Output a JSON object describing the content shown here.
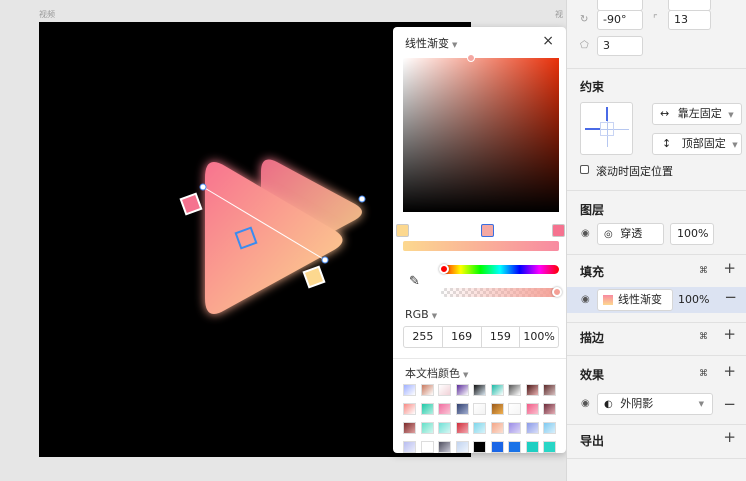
{
  "canvas": {
    "label_left": "视频",
    "label_right": "视"
  },
  "color_picker": {
    "fill_type": "线性渐变",
    "close": "×",
    "stops": [
      "#fcd88f",
      "#f4a8a3",
      "#f5728f"
    ],
    "gradient": [
      "#fcd88f",
      "#f88aa1"
    ],
    "mode": "RGB",
    "values": [
      "255",
      "169",
      "159",
      "100%"
    ],
    "document_colors": "本文档颜色"
  },
  "panel": {
    "rotation": "-90°",
    "radius": "13",
    "sides": "3",
    "constraints": {
      "title": "约束",
      "horizontal": "靠左固定",
      "vertical": "顶部固定",
      "fixed_scroll": "滚动时固定位置"
    },
    "layer": {
      "title": "图层",
      "blend": "穿透",
      "opacity": "100%"
    },
    "fill": {
      "title": "填充",
      "type": "线性渐变",
      "opacity": "100%"
    },
    "stroke": {
      "title": "描边"
    },
    "effects": {
      "title": "效果",
      "shadow": "外阴影"
    },
    "export": {
      "title": "导出"
    }
  }
}
